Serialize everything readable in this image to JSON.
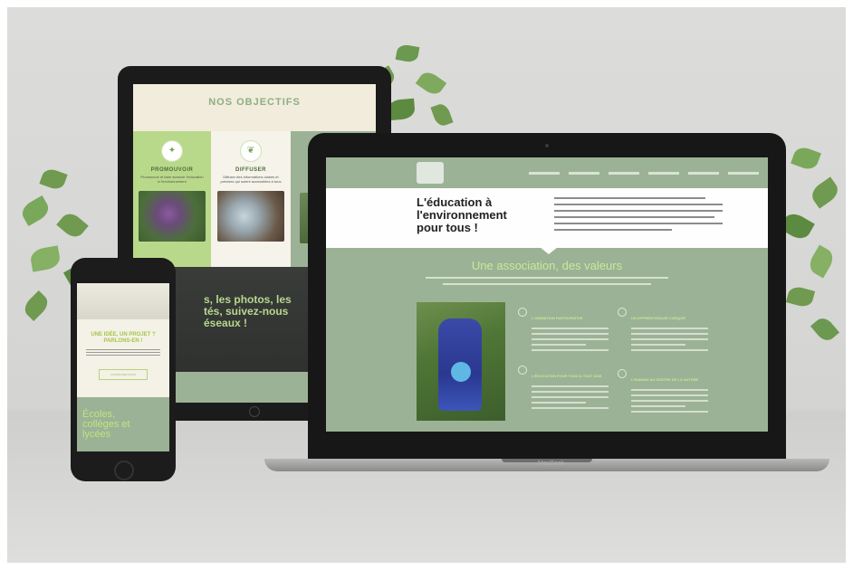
{
  "tablet": {
    "title": "NOS OBJECTIFS",
    "col1_title": "PROMOUVOIR",
    "col1_text": "Promouvoir et faire avancer l'éducation à l'environnement",
    "col2_title": "DIFFUSER",
    "col2_text": "Diffuser des informations claires et précises qui soient accessibles à tous",
    "social_text": "s, les photos, les\ntés, suivez-nous\néseaux !"
  },
  "phone": {
    "question": "UNE IDÉE, UN PROJET ?\nPARLONS-EN !",
    "button": "CONTACTEZ-NOUS",
    "bottom_title": "Écoles,\ncollèges et\nlycées"
  },
  "laptop": {
    "hero_title": "L'éducation à\nl'environnement\npour tous !",
    "section_title": "Une association, des valeurs",
    "col_a1": "L'ANIMATION PARTICIPATIVE",
    "col_a2": "L'ÉDUCATION POUR TOUS À TOUT ÂGE",
    "col_b1": "UN APPRENTISSAGE LUDIQUE",
    "col_b2": "L'HUMAIN AU CENTRE DE LA NATURE",
    "brand": "MacBook"
  }
}
